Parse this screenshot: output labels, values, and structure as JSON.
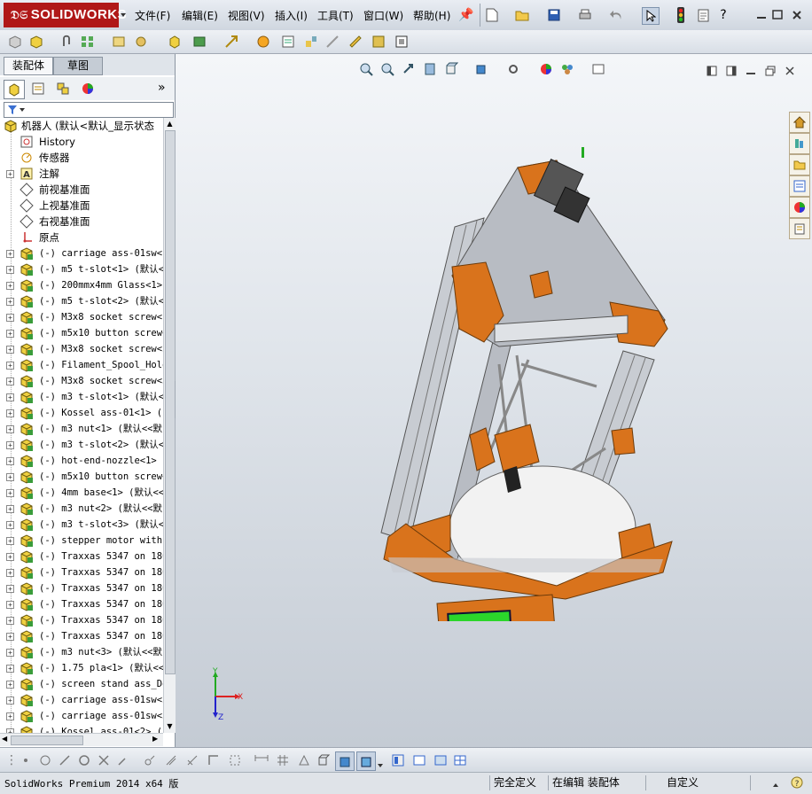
{
  "app": {
    "logo_text": "SOLIDWORKS",
    "menu": [
      "文件(F)",
      "编辑(E)",
      "视图(V)",
      "插入(I)",
      "工具(T)",
      "窗口(W)",
      "帮助(H)"
    ]
  },
  "left_panel": {
    "tabs": [
      "装配体",
      "草图"
    ],
    "expand_glyph": "»",
    "tree": [
      {
        "label": "机器人  (默认<默认_显示状态",
        "kind": "assembly",
        "expand": false
      },
      {
        "label": "History",
        "kind": "history",
        "expand": false
      },
      {
        "label": "传感器",
        "kind": "sensor",
        "expand": false
      },
      {
        "label": "注解",
        "kind": "annotation",
        "expand": true
      },
      {
        "label": "前视基准面",
        "kind": "plane",
        "expand": false
      },
      {
        "label": "上视基准面",
        "kind": "plane",
        "expand": false
      },
      {
        "label": "右视基准面",
        "kind": "plane",
        "expand": false
      },
      {
        "label": "原点",
        "kind": "origin",
        "expand": false
      },
      {
        "label": "(-) carriage ass-01sw<1",
        "kind": "part",
        "expand": true
      },
      {
        "label": "(-) m5 t-slot<1> (默认<",
        "kind": "part",
        "expand": true
      },
      {
        "label": "(-) 200mmx4mm Glass<1>",
        "kind": "part",
        "expand": true
      },
      {
        "label": "(-) m5 t-slot<2> (默认<",
        "kind": "part",
        "expand": true
      },
      {
        "label": "(-) M3x8 socket screw<1",
        "kind": "part",
        "expand": true
      },
      {
        "label": "(-) m5x10 button screw<",
        "kind": "part",
        "expand": true
      },
      {
        "label": "(-) M3x8 socket screw<2",
        "kind": "part",
        "expand": true
      },
      {
        "label": "(-) Filament_Spool_Hold",
        "kind": "part",
        "expand": true
      },
      {
        "label": "(-) M3x8 socket screw<3",
        "kind": "part",
        "expand": true
      },
      {
        "label": "(-) m3 t-slot<1> (默认<",
        "kind": "part",
        "expand": true
      },
      {
        "label": "(-) Kossel ass-01<1> (",
        "kind": "part",
        "expand": true
      },
      {
        "label": "(-) m3 nut<1> (默认<<默",
        "kind": "part",
        "expand": true
      },
      {
        "label": "(-) m3 t-slot<2> (默认<",
        "kind": "part",
        "expand": true
      },
      {
        "label": "(-) hot-end-nozzle<1> (",
        "kind": "part",
        "expand": true
      },
      {
        "label": "(-) m5x10 button screw<",
        "kind": "part",
        "expand": true
      },
      {
        "label": "(-) 4mm base<1> (默认<<",
        "kind": "part",
        "expand": true
      },
      {
        "label": "(-) m3 nut<2> (默认<<默",
        "kind": "part",
        "expand": true
      },
      {
        "label": "(-) m3 t-slot<3> (默认<",
        "kind": "part",
        "expand": true
      },
      {
        "label": "(-) stepper motor with",
        "kind": "part",
        "expand": true
      },
      {
        "label": "(-) Traxxas 5347 on 180",
        "kind": "part",
        "expand": true
      },
      {
        "label": "(-) Traxxas 5347 on 180",
        "kind": "part",
        "expand": true
      },
      {
        "label": "(-) Traxxas 5347 on 180",
        "kind": "part",
        "expand": true
      },
      {
        "label": "(-) Traxxas 5347 on 180",
        "kind": "part",
        "expand": true
      },
      {
        "label": "(-) Traxxas 5347 on 180",
        "kind": "part",
        "expand": true
      },
      {
        "label": "(-) Traxxas 5347 on 180",
        "kind": "part",
        "expand": true
      },
      {
        "label": "(-) m3 nut<3> (默认<<默",
        "kind": "part",
        "expand": true
      },
      {
        "label": "(-) 1.75 pla<1> (默认<<",
        "kind": "part",
        "expand": true
      },
      {
        "label": "(-) screen stand ass_De",
        "kind": "part",
        "expand": true
      },
      {
        "label": "(-) carriage ass-01sw<2",
        "kind": "part",
        "expand": true
      },
      {
        "label": "(-) carriage ass-01sw<3",
        "kind": "part",
        "expand": true
      },
      {
        "label": "(-) Kossel ass-01<2> (",
        "kind": "part",
        "expand": true
      }
    ]
  },
  "status": {
    "product": "SolidWorks Premium 2014 x64 版",
    "definition": "完全定义",
    "editing": "在编辑 装配体",
    "units": "自定义"
  },
  "triad": {
    "x": "X",
    "y": "Y",
    "z": "Z"
  },
  "colors": {
    "brand_red": "#b01818",
    "part_orange": "#d9731c",
    "lcd_green": "#2bd62b"
  }
}
